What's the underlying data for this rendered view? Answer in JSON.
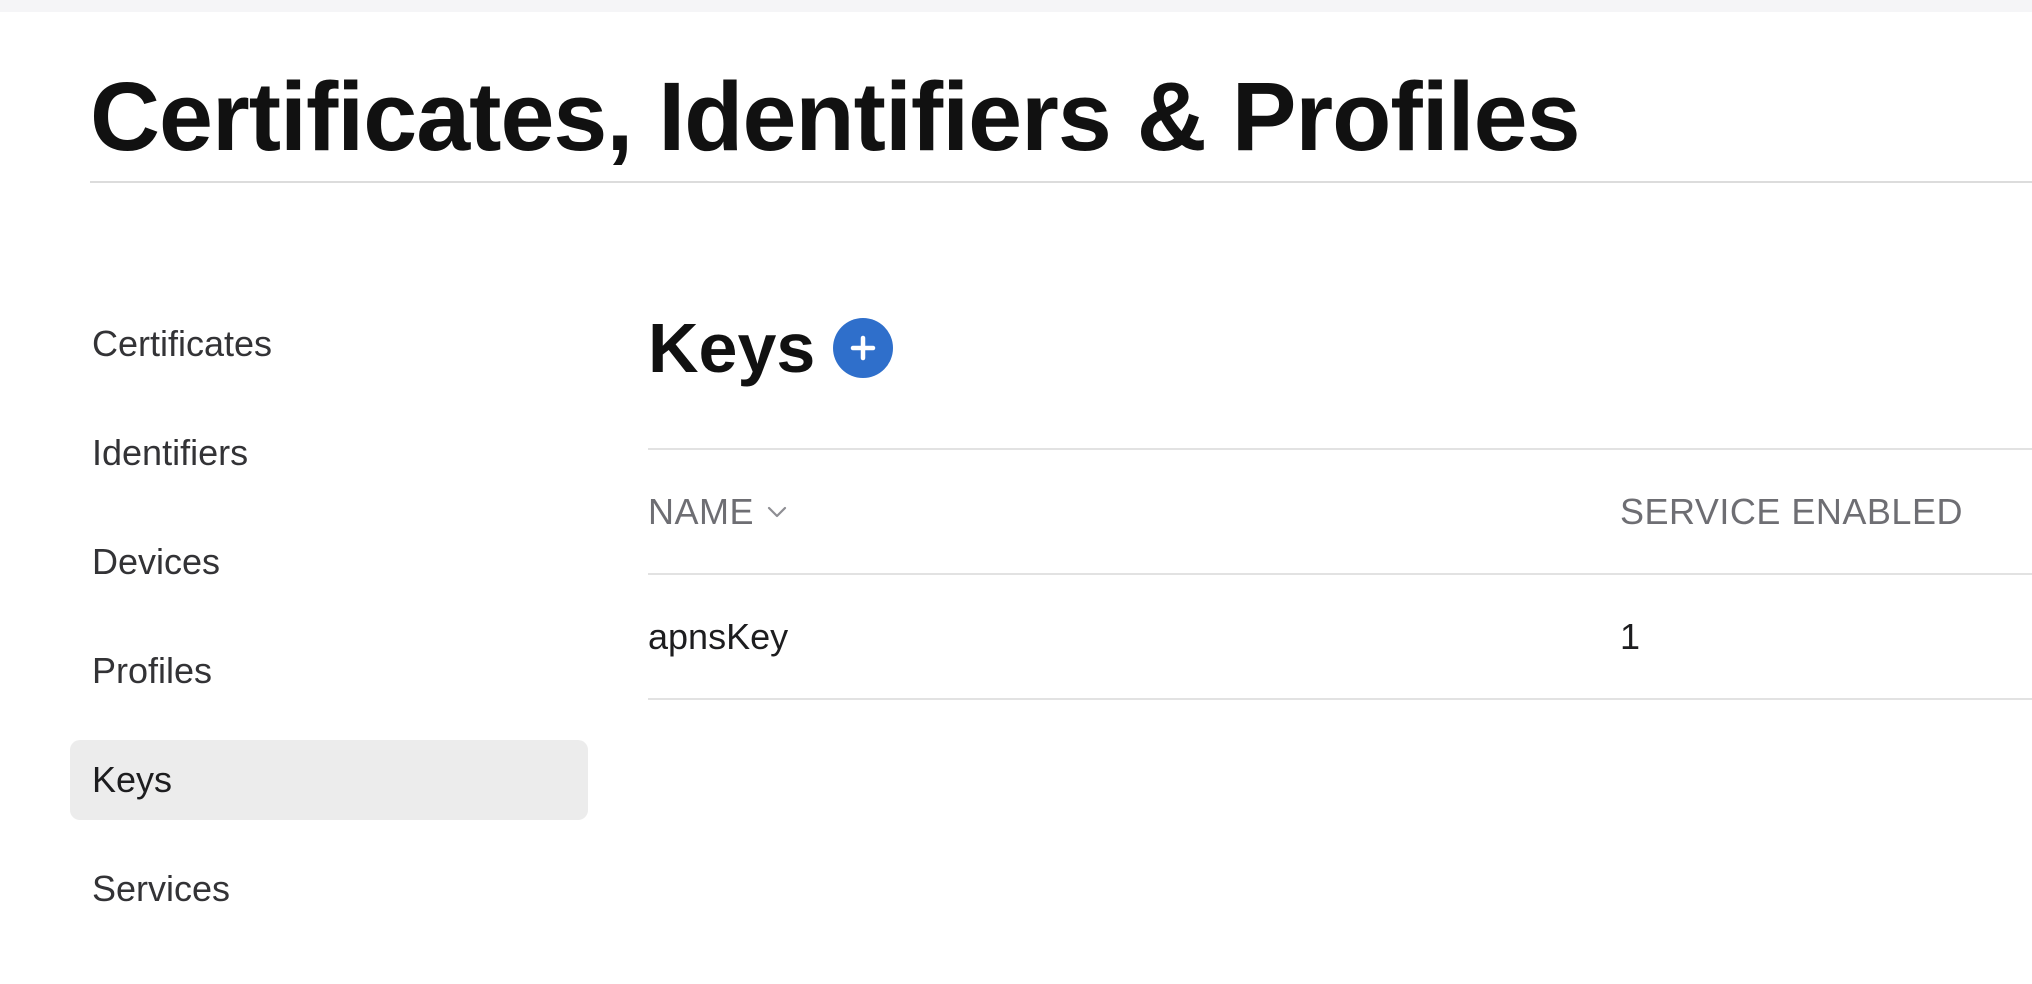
{
  "page": {
    "title": "Certificates, Identifiers & Profiles"
  },
  "sidebar": {
    "items": [
      {
        "label": "Certificates",
        "active": false
      },
      {
        "label": "Identifiers",
        "active": false
      },
      {
        "label": "Devices",
        "active": false
      },
      {
        "label": "Profiles",
        "active": false
      },
      {
        "label": "Keys",
        "active": true
      },
      {
        "label": "Services",
        "active": false
      }
    ]
  },
  "main": {
    "section_title": "Keys",
    "add_icon": "plus-circle-icon",
    "table": {
      "columns": [
        {
          "label": "NAME",
          "sort_icon": "chevron-down-icon"
        },
        {
          "label": "SERVICE ENABLED"
        }
      ],
      "rows": [
        {
          "name": "apnsKey",
          "service_enabled": "1"
        }
      ]
    }
  },
  "colors": {
    "accent": "#2f6fcb",
    "active_item_bg": "#ececec",
    "divider": "#e2e2e2",
    "header_text": "#6e6e73"
  }
}
